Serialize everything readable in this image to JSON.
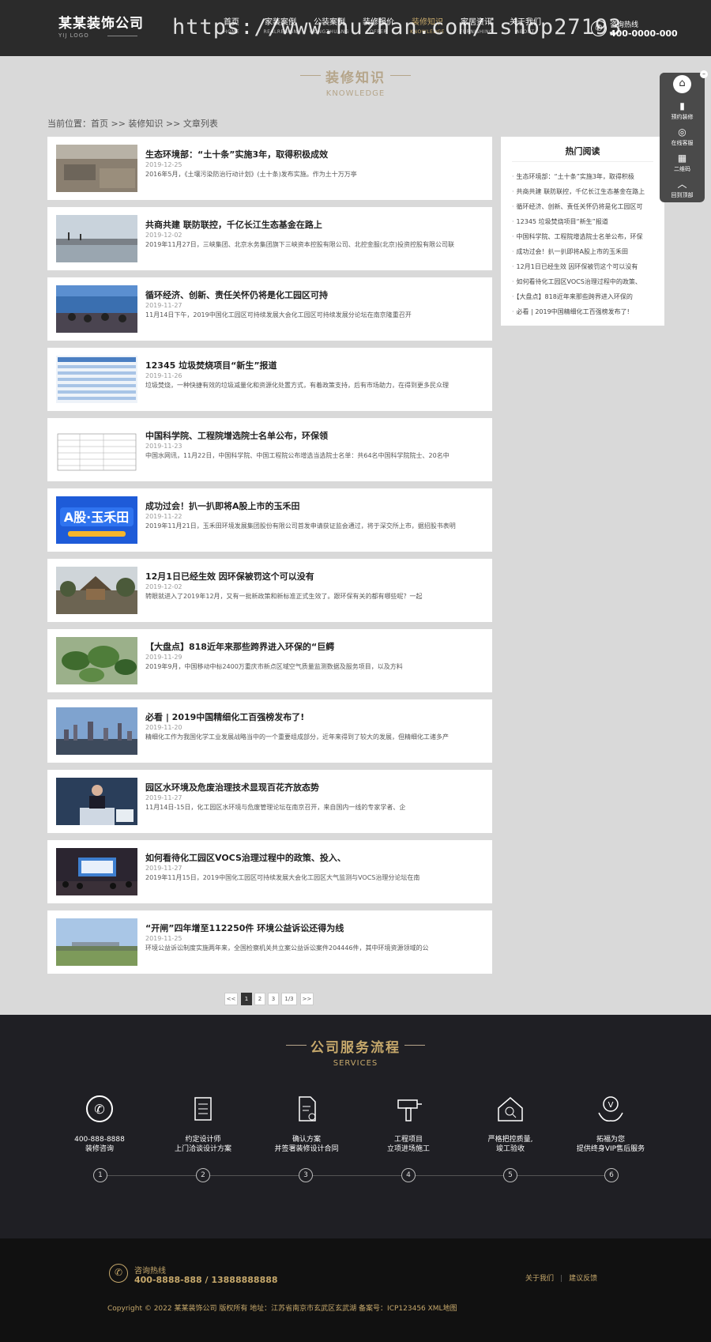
{
  "header": {
    "logo_name": "某某装饰公司",
    "logo_sub": "YIJ LOGO",
    "nav": [
      {
        "cn": "首页",
        "en": "HOME"
      },
      {
        "cn": "家装案例",
        "en": "REALRESIGN"
      },
      {
        "cn": "公装案例",
        "en": "GONGZHUANG"
      },
      {
        "cn": "装修报价",
        "en": "OFFER"
      },
      {
        "cn": "装修知识",
        "en": "KNOWLEDGE"
      },
      {
        "cn": "家居资讯",
        "en": "FURNISHING"
      },
      {
        "cn": "关于我们",
        "en": "ABOUT"
      }
    ],
    "hotline_label": "咨询热线",
    "hotline_number": "400-0000-000",
    "watermark": "https://www.huzhan.com/ishop27193"
  },
  "page_title": {
    "cn": "装修知识",
    "en": "KNOWLEDGE"
  },
  "breadcrumb": "当前位置：首页 >> 装修知识 >> 文章列表",
  "articles": [
    {
      "title": "生态环境部：“土十条”实施3年，取得积极成效",
      "date": "2019-12-25",
      "summary": "2016年5月，《土壤污染防治行动计划》(土十条)发布实施。作为土十万万亭"
    },
    {
      "title": "共商共建 联防联控，千亿长江生态基金在路上",
      "date": "2019-12-02",
      "summary": "2019年11月27日，三峡集团、北京水务集团旗下三峡资本控股有限公司、北控金服(北京)投资控股有限公司联"
    },
    {
      "title": "循环经济、创新、责任关怀仍将是化工园区可持",
      "date": "2019-11-27",
      "summary": "11月14日下午，2019中国化工园区可持续发展大会化工园区可持续发展分论坛在南京隆重召开"
    },
    {
      "title": "12345 垃圾焚烧项目“新生”报道",
      "date": "2019-11-26",
      "summary": "垃圾焚烧，一种快捷有效的垃圾减量化和资源化处置方式，有着政策支持，后有市场助力，在得到更多民众理"
    },
    {
      "title": "中国科学院、工程院增选院士名单公布，环保领",
      "date": "2019-11-23",
      "summary": "中国水网讯，11月22日，中国科学院、中国工程院公布增选当选院士名单：共64名中国科学院院士、20名中"
    },
    {
      "title": "成功过会！扒一扒即将A股上市的玉禾田",
      "date": "2019-11-22",
      "summary": "2019年11月21日，玉禾田环境发展集团股份有限公司首发申请获证监会通过，将于深交所上市，据招股书表明"
    },
    {
      "title": "12月1日已经生效 因环保被罚这个可以没有",
      "date": "2019-12-02",
      "summary": "转眼就进入了2019年12月，又有一批新政策和新标准正式生效了。跟环保有关的都有哪些呢？一起"
    },
    {
      "title": "【大盘点】818近年来那些跨界进入环保的“巨鳄",
      "date": "2019-11-29",
      "summary": "2019年9月，中国移动中标2400万重庆市新点区域空气质量监测数据及服务项目，以及方料"
    },
    {
      "title": "必看 | 2019中国精细化工百强榜发布了!",
      "date": "2019-11-20",
      "summary": "精细化工作为我国化学工业发展战略当中的一个重要组成部分，近年来得到了较大的发展，但精细化工诸多产"
    },
    {
      "title": "园区水环境及危废治理技术显现百花齐放态势",
      "date": "2019-11-27",
      "summary": "11月14日-15日，化工园区水环境与危废管理论坛在南京召开，来自国内一线的专家学者、企"
    },
    {
      "title": "如何看待化工园区VOCS治理过程中的政策、投入、",
      "date": "2019-11-27",
      "summary": "2019年11月15日，2019中国化工园区可持续发展大会化工园区大气监测与VOCS治理分论坛在南"
    },
    {
      "title": "“开闸”四年增至112250件 环境公益诉讼还得为线",
      "date": "2019-11-25",
      "summary": "环境公益诉讼制度实施两年来，全国检察机关共立案公益诉讼案件204446件，其中环境资源领域的公"
    }
  ],
  "sidebar": {
    "heading": "热门阅读",
    "items": [
      "生态环境部：“土十条”实施3年，取得积极",
      "共商共建 联防联控，千亿长江生态基金在路上",
      "循环经济、创新、责任关怀仍将是化工园区可",
      "12345 垃圾焚烧项目“新生”报道",
      "中国科学院、工程院增选院士名单公布，环保",
      "成功过会！扒一扒即将A股上市的玉禾田",
      "12月1日已经生效 因环保被罚这个可以没有",
      "如何看待化工园区VOCS治理过程中的政策、",
      "【大盘点】818近年来那些跨界进入环保的",
      "必看 | 2019中国精细化工百强榜发布了!"
    ]
  },
  "float_bar": {
    "items": [
      {
        "label": "预约装修",
        "icon": "brush-icon"
      },
      {
        "label": "在线客服",
        "icon": "chat-icon"
      },
      {
        "label": "二维码",
        "icon": "qrcode-icon"
      },
      {
        "label": "回到顶部",
        "icon": "arrow-up-icon"
      }
    ]
  },
  "pagination": {
    "prev": "<<",
    "pages": [
      "1",
      "2",
      "3"
    ],
    "current": "1",
    "total": "1/3",
    "next": ">>"
  },
  "services": {
    "title_cn": "公司服务流程",
    "title_en": "SERVICES",
    "steps": [
      {
        "t1": "400-888-8888",
        "t2": "装修咨询",
        "num": "1",
        "icon": "phone-icon"
      },
      {
        "t1": "约定设计师",
        "t2": "上门洽谈设计方案",
        "num": "2",
        "icon": "clipboard-icon"
      },
      {
        "t1": "确认方案",
        "t2": "并签署装修设计合同",
        "num": "3",
        "icon": "contract-icon"
      },
      {
        "t1": "工程项目",
        "t2": "立项进场施工",
        "num": "4",
        "icon": "drill-icon"
      },
      {
        "t1": "严格把控质量,",
        "t2": "竣工验收",
        "num": "5",
        "icon": "house-search-icon"
      },
      {
        "t1": "拓福为您",
        "t2": "提供终身VIP售后服务",
        "num": "6",
        "icon": "hands-icon"
      }
    ]
  },
  "footer": {
    "hotline_label": "咨询热线",
    "hotline_numbers": "400-8888-888 / 13888888888",
    "links": [
      "关于我们",
      "建议反馈"
    ],
    "copyright": "Copyright © 2022 某某装饰公司 版权所有    地址：江苏省南京市玄武区玄武湖    备案号：ICP123456    XML地图"
  },
  "colors": {
    "accent": "#c6a86b",
    "title": "#b5a58a",
    "header_bg": "#2b2b2b",
    "services_bg": "#1f1f24",
    "footer_bg": "#111111",
    "page_bg": "#d9d9d9"
  }
}
